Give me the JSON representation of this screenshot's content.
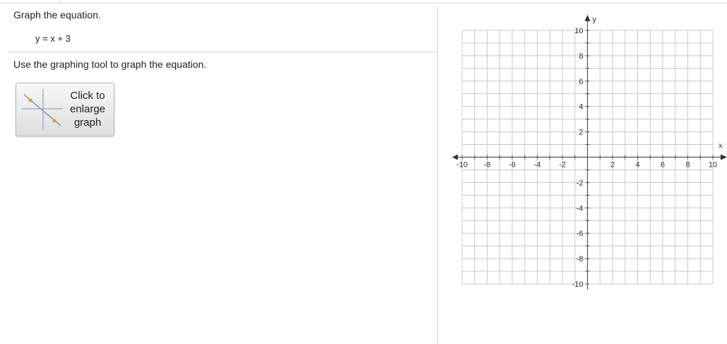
{
  "question": {
    "instruction": "Graph the equation.",
    "equation": "y = x + 3",
    "tool_instruction": "Use the graphing tool to graph the equation.",
    "enlarge_button_label": "Click to enlarge graph"
  },
  "graph": {
    "x_axis_label": "x",
    "y_axis_label": "y",
    "x_range": [
      -10,
      10
    ],
    "y_range": [
      -10,
      10
    ],
    "grid_step": 1,
    "label_step": 2,
    "x_tick_labels": [
      "-10",
      "-8",
      "-6",
      "-4",
      "-2",
      "2",
      "4",
      "6",
      "8",
      "10"
    ],
    "y_tick_labels": [
      "10",
      "8",
      "6",
      "4",
      "2",
      "-2",
      "-4",
      "-6",
      "-8",
      "-10"
    ],
    "grid_color": "#c8c8c8",
    "axis_color": "#555555"
  }
}
